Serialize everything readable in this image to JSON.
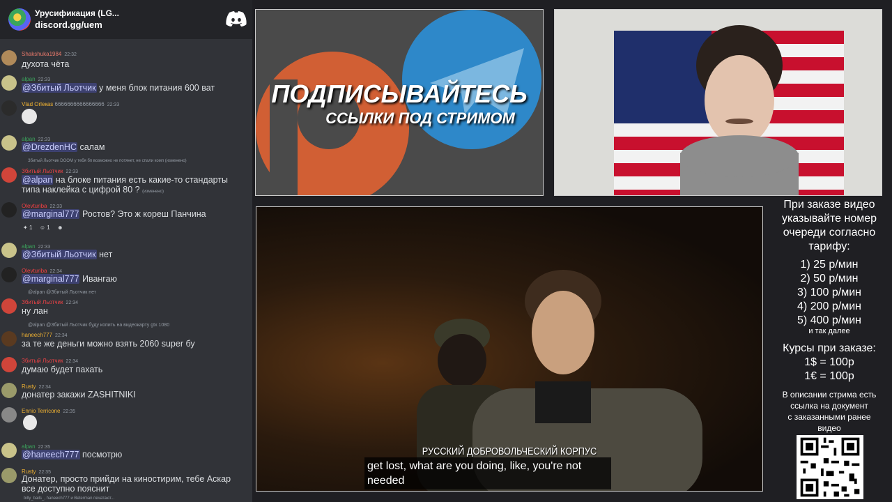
{
  "discord": {
    "server_name": "Урусификация (LG...",
    "invite": "discord.gg/uem",
    "messages": [
      {
        "user": "Shakshuka1984",
        "time": "22:32",
        "text": "духота чёта",
        "color": "#e8796b"
      },
      {
        "user": "alpan",
        "time": "22:33",
        "mention": "@Збитый Льотчик",
        "text": "у меня блок питания 600 ват",
        "color": "#3ba55d"
      },
      {
        "user": "Vlad Orleкas",
        "badge": "6666666666666666",
        "time": "22:33",
        "text": "",
        "color": "#f0b232"
      },
      {
        "user": "alpan",
        "time": "22:33",
        "mention": "@DrezdenHC",
        "text": "салам",
        "color": "#3ba55d"
      },
      {
        "user": "Збитый Льотчик",
        "time": "22:33",
        "reply": "Збитый Льотчик  DOOM  у тебя бп возможно не потянет, не спали комп (изменено)",
        "mention": "@alpan",
        "text": "на блоке питания есть какие-то стандарты",
        "text2": "типа наклейка с цифрой 80 ?",
        "edited": "(изменено)",
        "color": "#ed4245"
      },
      {
        "user": "Olevturiba",
        "time": "22:33",
        "mention": "@marginal777",
        "text": "Ростов? Это ж кореш Панчина",
        "reactions": [
          "1",
          "1"
        ],
        "color": "#f23f43"
      },
      {
        "user": "alpan",
        "time": "22:33",
        "mention": "@Збитый Льотчик",
        "text": "нет",
        "color": "#3ba55d"
      },
      {
        "user": "Olevturiba",
        "time": "22:34",
        "mention": "@marginal777",
        "text": "Ивангаю",
        "color": "#f23f43"
      },
      {
        "user": "Збитый Льотчик",
        "time": "22:34",
        "reply": "@alpan @Збитый Льотчик нет",
        "text": "ну лан",
        "color": "#ed4245"
      },
      {
        "user": "haneech777",
        "time": "22:34",
        "reply": "@alpan @Збитый Льотчик буду копить на видеокарту gtx 1080",
        "text": "за те же деньги можно взять 2060 super бу",
        "color": "#f0b232"
      },
      {
        "user": "Збитый Льотчик",
        "time": "22:34",
        "text": "думаю будет пахать",
        "color": "#ed4245"
      },
      {
        "user": "Rusty",
        "time": "22:34",
        "text": "донатер закажи ZASHITNIKI",
        "color": "#f0b232"
      },
      {
        "user": "Ennio Terricone",
        "time": "22:35",
        "text": "",
        "color": "#f0b232"
      },
      {
        "user": "alpan",
        "time": "22:35",
        "mention": "@haneech777",
        "text": "посмотрю",
        "color": "#3ba55d"
      },
      {
        "user": "Rusty",
        "time": "22:35",
        "text": "Донатер, просто прийди на киностирим, тебе Аскар",
        "text2": "все доступно пояснит",
        "color": "#f0b232"
      }
    ],
    "typing": "billy_bails_, haneech777 и Beterman печатают..."
  },
  "promo": {
    "title": "ПОДПИСЫВАЙТЕСЬ",
    "subtitle": "ССЫЛКИ ПОД СТРИМОМ"
  },
  "video": {
    "overlay_title": "РУССКИЙ ДОБРОВОЛЬЧЕСКИЙ КОРПУС",
    "subtitle_line1": "get lost, what are you doing, like, you're not",
    "subtitle_line2": "needed"
  },
  "info": {
    "order_note": [
      "При заказе видео",
      "указывайте номер",
      "очереди согласно",
      "тарифу:"
    ],
    "tariffs": [
      "1) 25 р/мин",
      "2) 50 р/мин",
      "3) 100 р/мин",
      "4) 200 р/мин",
      "5) 400 р/мин"
    ],
    "and_more": "и так далее",
    "rates_title": "Курсы при заказе:",
    "rates": [
      "1$ = 100р",
      "1€ = 100р"
    ],
    "description_note": [
      "В описании стрима есть",
      "ссылка на документ",
      "с заказанными ранее",
      "видео"
    ]
  }
}
